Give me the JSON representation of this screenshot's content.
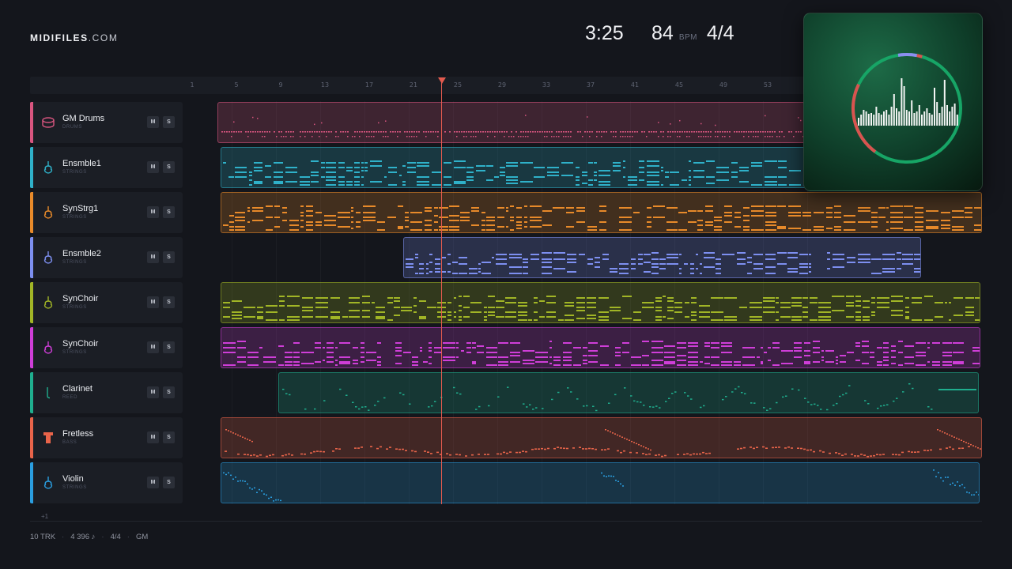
{
  "brand": {
    "name": "MIDIFILES",
    "suffix": ".COM"
  },
  "transport": {
    "time": "3:25",
    "tempo": "84",
    "tempo_unit": "BPM",
    "time_signature": "4/4"
  },
  "ruler": {
    "bars": [
      "1",
      "5",
      "9",
      "13",
      "17",
      "21",
      "25",
      "29",
      "33",
      "37",
      "41",
      "45",
      "49",
      "53"
    ]
  },
  "controls": {
    "mute_label": "M",
    "solo_label": "S"
  },
  "tracks": [
    {
      "name": "GM Drums",
      "category": "DRUMS",
      "color": "#d8557f",
      "icon": "drum-icon"
    },
    {
      "name": "Ensmble1",
      "category": "STRINGS",
      "color": "#2fb1c9",
      "icon": "violin-icon"
    },
    {
      "name": "SynStrg1",
      "category": "STRINGS",
      "color": "#e88a2a",
      "icon": "violin-icon"
    },
    {
      "name": "Ensmble2",
      "category": "STRINGS",
      "color": "#7d8ff0",
      "icon": "violin-icon"
    },
    {
      "name": "SynChoir",
      "category": "STRINGS",
      "color": "#a1b526",
      "icon": "violin-icon"
    },
    {
      "name": "SynChoir",
      "category": "STRINGS",
      "color": "#cf3ed8",
      "icon": "violin-icon"
    },
    {
      "name": "Clarinet",
      "category": "REED",
      "color": "#1fae8e",
      "icon": "clarinet-icon"
    },
    {
      "name": "Fretless",
      "category": "BASS",
      "color": "#e8644a",
      "icon": "bass-icon"
    },
    {
      "name": "Violin",
      "category": "STRINGS",
      "color": "#2a9ee0",
      "icon": "violin-icon"
    }
  ],
  "more_tracks": "+1",
  "footer": {
    "tracks": "10 TRK",
    "notes": "4 396 ♪",
    "signature": "4/4",
    "standard": "GM"
  }
}
